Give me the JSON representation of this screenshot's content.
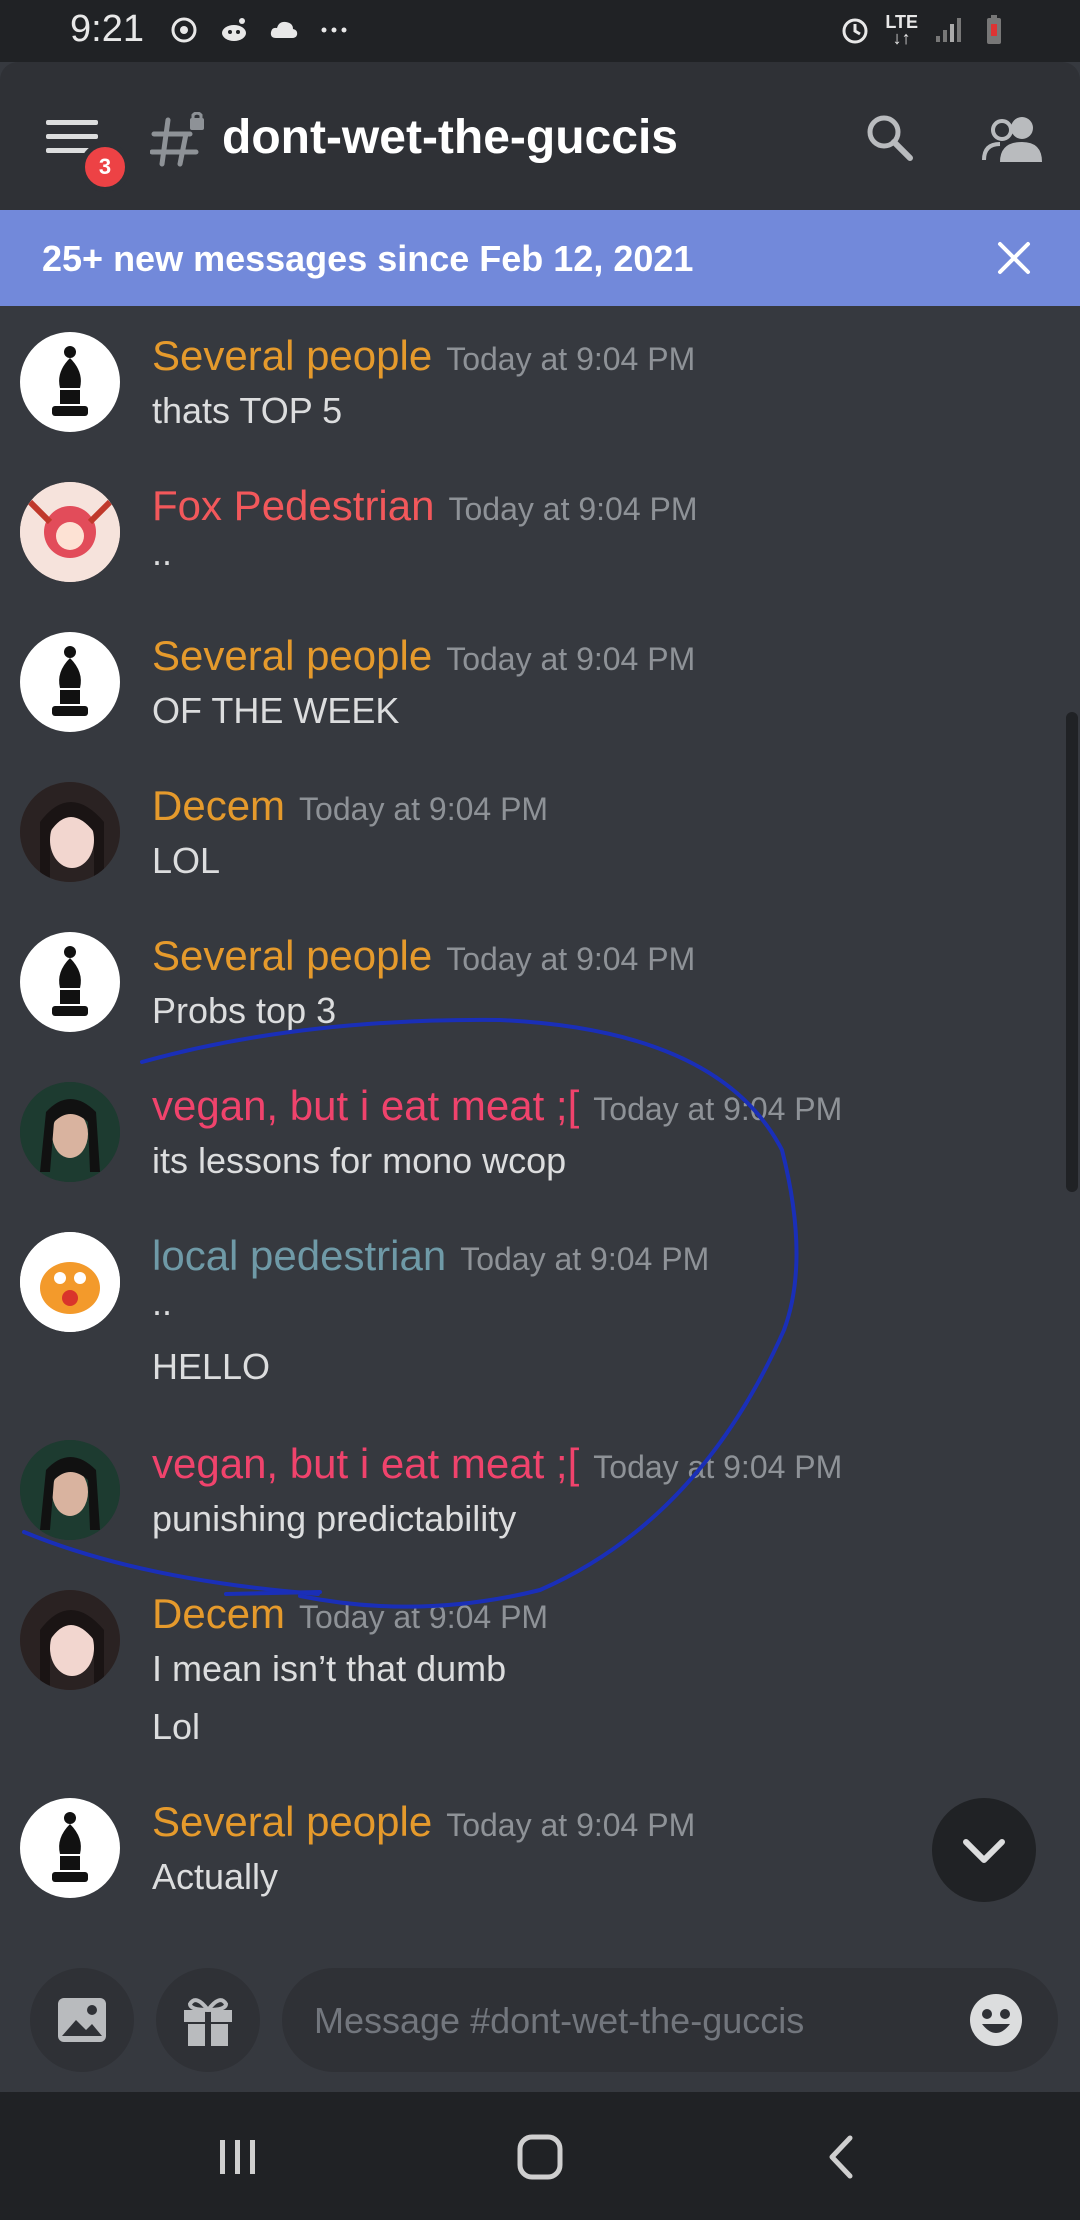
{
  "status_bar": {
    "time": "9:21",
    "lte_label": "LTE",
    "icons": [
      "sync-icon",
      "reddit-icon",
      "cloud-icon",
      "more-dots-icon",
      "alarm-icon",
      "signal-icon",
      "battery-icon"
    ]
  },
  "header": {
    "notification_count": "3",
    "channel_name": "dont-wet-the-guccis",
    "icons": [
      "hamburger-menu-icon",
      "locked-hashtag-icon",
      "search-icon",
      "members-icon"
    ]
  },
  "banner": {
    "text": "25+ new messages since Feb 12, 2021",
    "background_color": "#7289da"
  },
  "colors": {
    "orange_name": "#e59a2c",
    "red_name": "#f2585b",
    "pink_name": "#f0436c",
    "teal_name": "#6f9aa7",
    "background": "#36393f",
    "header": "#2f3136"
  },
  "messages": [
    {
      "author": "Several people",
      "timestamp": "Today at 9:04 PM",
      "lines": [
        "thats TOP 5"
      ],
      "avatar": "chess-bishop"
    },
    {
      "author": "Fox Pedestrian",
      "timestamp": "Today at 9:04 PM",
      "lines": [
        ".."
      ],
      "avatar": "anime-girl"
    },
    {
      "author": "Several people",
      "timestamp": "Today at 9:04 PM",
      "lines": [
        "OF THE WEEK"
      ],
      "avatar": "chess-bishop"
    },
    {
      "author": "Decem",
      "timestamp": "Today at 9:04 PM",
      "lines": [
        "LOL"
      ],
      "avatar": "photo-girl"
    },
    {
      "author": "Several people",
      "timestamp": "Today at 9:04 PM",
      "lines": [
        "Probs top 3"
      ],
      "avatar": "chess-bishop"
    },
    {
      "author": "vegan, but i eat meat ;[",
      "timestamp": "Today at 9:04 PM",
      "lines": [
        "its lessons for mono wcop"
      ],
      "avatar": "photo-woman"
    },
    {
      "author": "local pedestrian",
      "timestamp": "Today at 9:04 PM",
      "lines": [
        "..",
        "HELLO"
      ],
      "avatar": "cartoon-dragon"
    },
    {
      "author": "vegan, but i eat meat ;[",
      "timestamp": "Today at 9:04 PM",
      "lines": [
        "punishing predictability"
      ],
      "avatar": "photo-woman"
    },
    {
      "author": "Decem",
      "timestamp": "Today at 9:04 PM",
      "lines": [
        "I mean isn’t that dumb",
        "Lol"
      ],
      "avatar": "photo-girl"
    },
    {
      "author": "Several people",
      "timestamp": "Today at 9:04 PM",
      "lines": [
        "Actually"
      ],
      "avatar": "chess-bishop"
    }
  ],
  "composer": {
    "placeholder": "Message #dont-wet-the-guccis",
    "icons": [
      "image-upload-icon",
      "gift-icon",
      "emoji-icon"
    ]
  },
  "jump_button": {
    "icon": "chevron-down-icon"
  },
  "nav_bar": {
    "icons": [
      "recent-apps-icon",
      "home-icon",
      "back-icon"
    ]
  },
  "annotation": {
    "color": "#1a2fb8",
    "shape": "hand-drawn circle around messages"
  }
}
